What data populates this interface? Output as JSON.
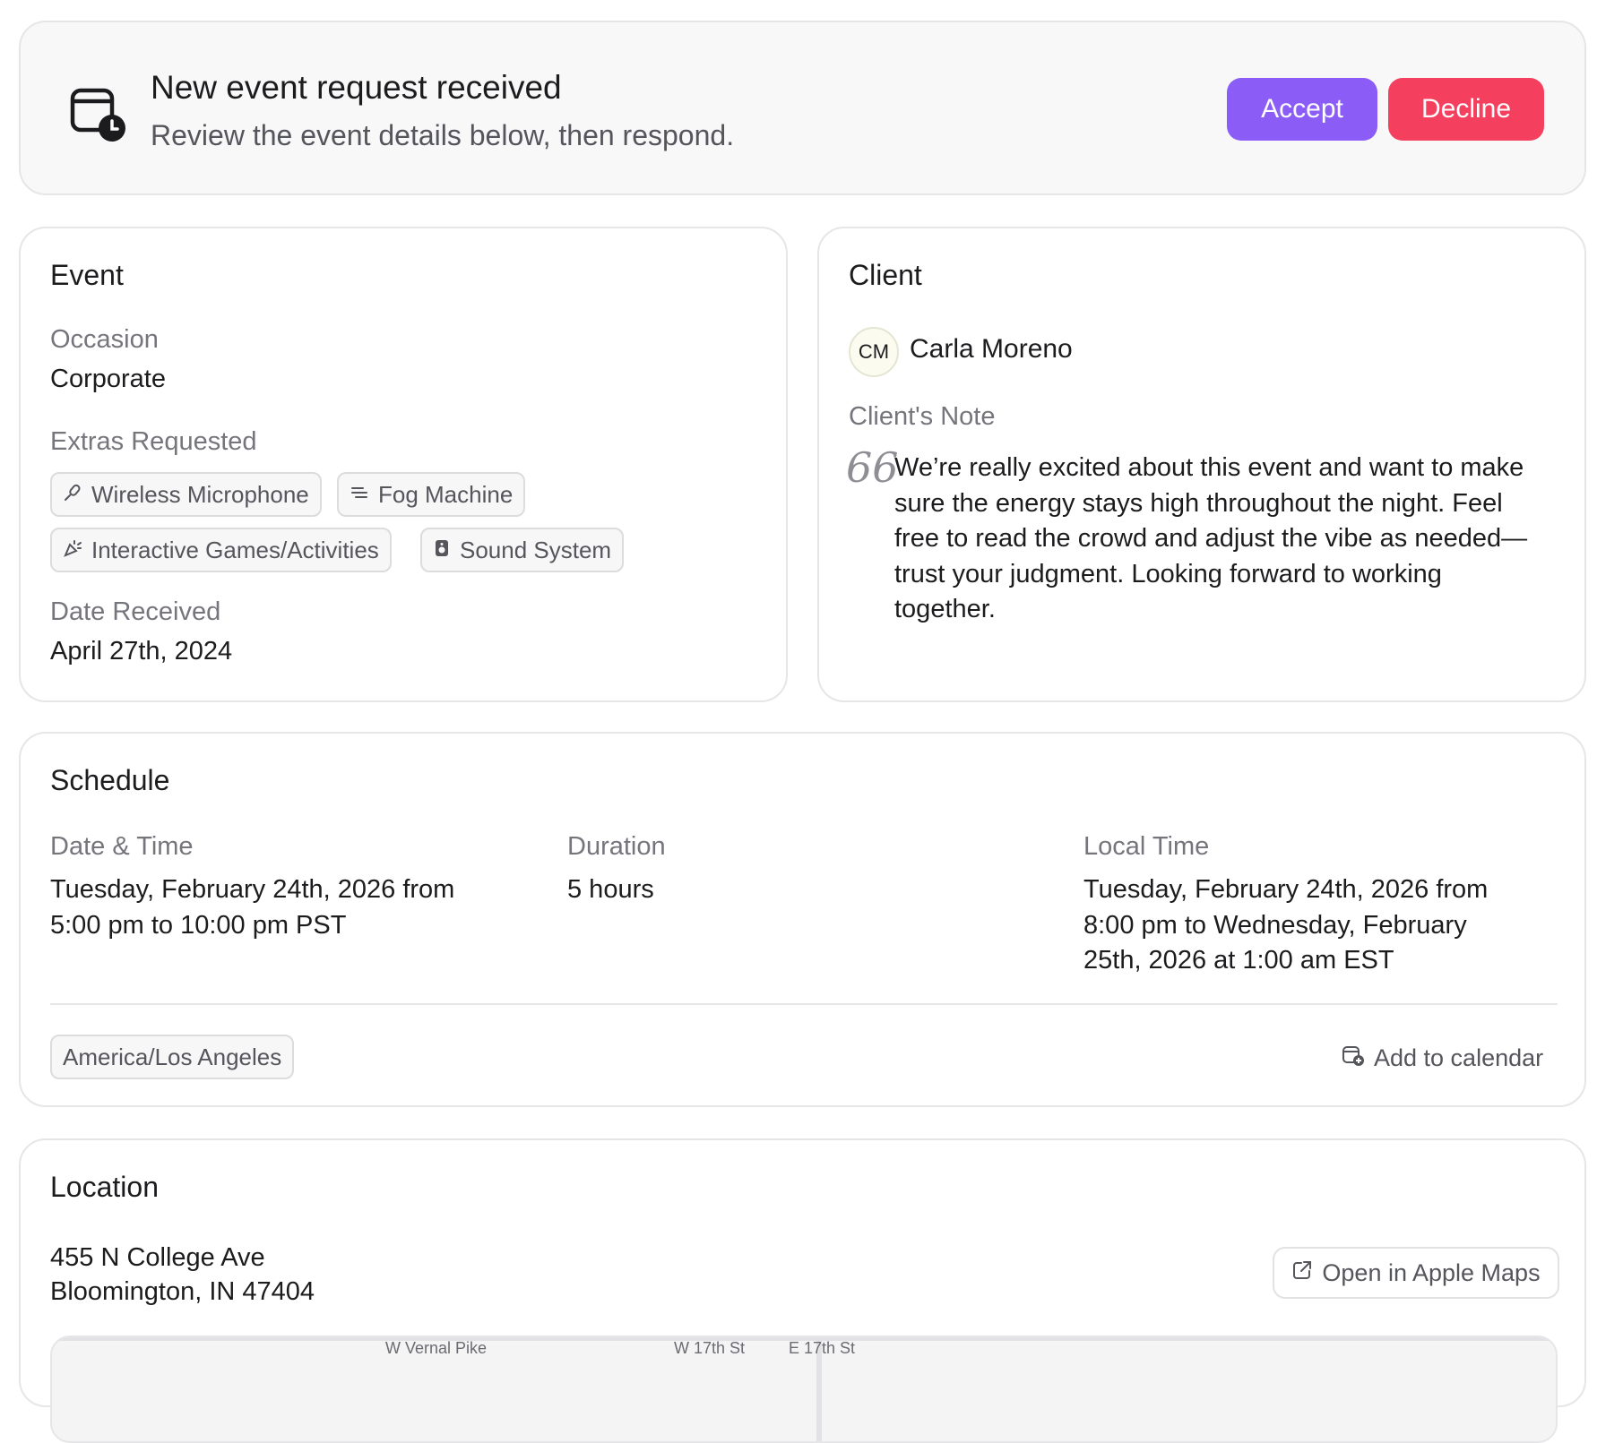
{
  "banner": {
    "icon": "calendar-clock-icon",
    "title": "New event request received",
    "subtitle": "Review the event details below, then respond.",
    "accept_label": "Accept",
    "decline_label": "Decline",
    "accept_color": "#8b5cf6",
    "decline_color": "#f43f5e"
  },
  "event": {
    "title": "Event",
    "occasion_label": "Occasion",
    "occasion_value": "Corporate",
    "extras_label": "Extras Requested",
    "extras": [
      {
        "icon": "microphone-icon",
        "label": "Wireless Microphone"
      },
      {
        "icon": "fog-icon",
        "label": "Fog Machine"
      },
      {
        "icon": "party-popper-icon",
        "label": "Interactive Games/Activities"
      },
      {
        "icon": "speaker-icon",
        "label": "Sound System"
      }
    ],
    "date_received_label": "Date Received",
    "date_received_value": "April 27th, 2024"
  },
  "client": {
    "title": "Client",
    "initials": "CM",
    "name": "Carla Moreno",
    "note_label": "Client's Note",
    "note_icon": "quote-icon",
    "note": "We’re really excited about this event and want to make sure the energy stays high throughout the night. Feel free to read the crowd and adjust the vibe as needed—trust your judgment. Looking forward to working together."
  },
  "schedule": {
    "title": "Schedule",
    "datetime_label": "Date & Time",
    "datetime_value": "Tuesday, February 24th, 2026 from 5:00 pm to 10:00 pm PST",
    "duration_label": "Duration",
    "duration_value": "5 hours",
    "local_label": "Local Time",
    "local_value": "Tuesday, February 24th, 2026 from 8:00 pm to Wednesday, February 25th, 2026 at 1:00 am EST",
    "timezone": "America/Los Angeles",
    "add_calendar_label": "Add to calendar"
  },
  "location": {
    "title": "Location",
    "address_line1": "455 N College Ave",
    "address_line2": "Bloomington, IN 47404",
    "maps_label": "Open in Apple Maps",
    "streets": [
      "W Vernal Pike",
      "W 17th St",
      "E 17th St"
    ]
  }
}
